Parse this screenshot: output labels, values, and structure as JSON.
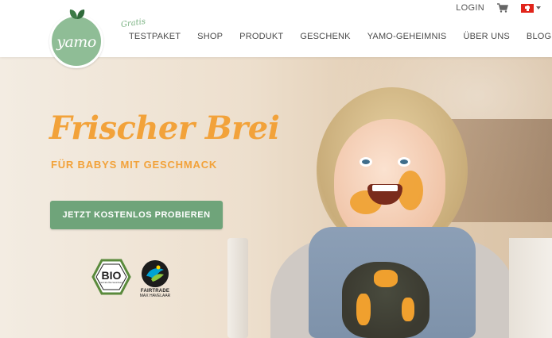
{
  "header": {
    "login_label": "LOGIN",
    "cart_icon": "cart-icon",
    "country_flag": "swiss-flag-icon",
    "logo_text": "yamo",
    "nav_badge": "Gratis",
    "nav_items": [
      "TESTPAKET",
      "SHOP",
      "PRODUKT",
      "GESCHENK",
      "YAMO-GEHEIMNIS",
      "ÜBER UNS",
      "BLOG"
    ]
  },
  "hero": {
    "headline": "Frischer Brei",
    "subline": "FÜR BABYS MIT GESCHMACK",
    "cta_label": "JETZT KOSTENLOS PROBIEREN"
  },
  "badges": {
    "bio_text": "BIO",
    "bio_sub": "nach EG-Öko-Verordnung",
    "fairtrade_label": "FAIRTRADE",
    "fairtrade_sub": "MAX HAVELAAR"
  },
  "colors": {
    "accent_orange": "#f2a23a",
    "brand_green": "#6fa47a",
    "logo_green": "#8fbd96"
  }
}
